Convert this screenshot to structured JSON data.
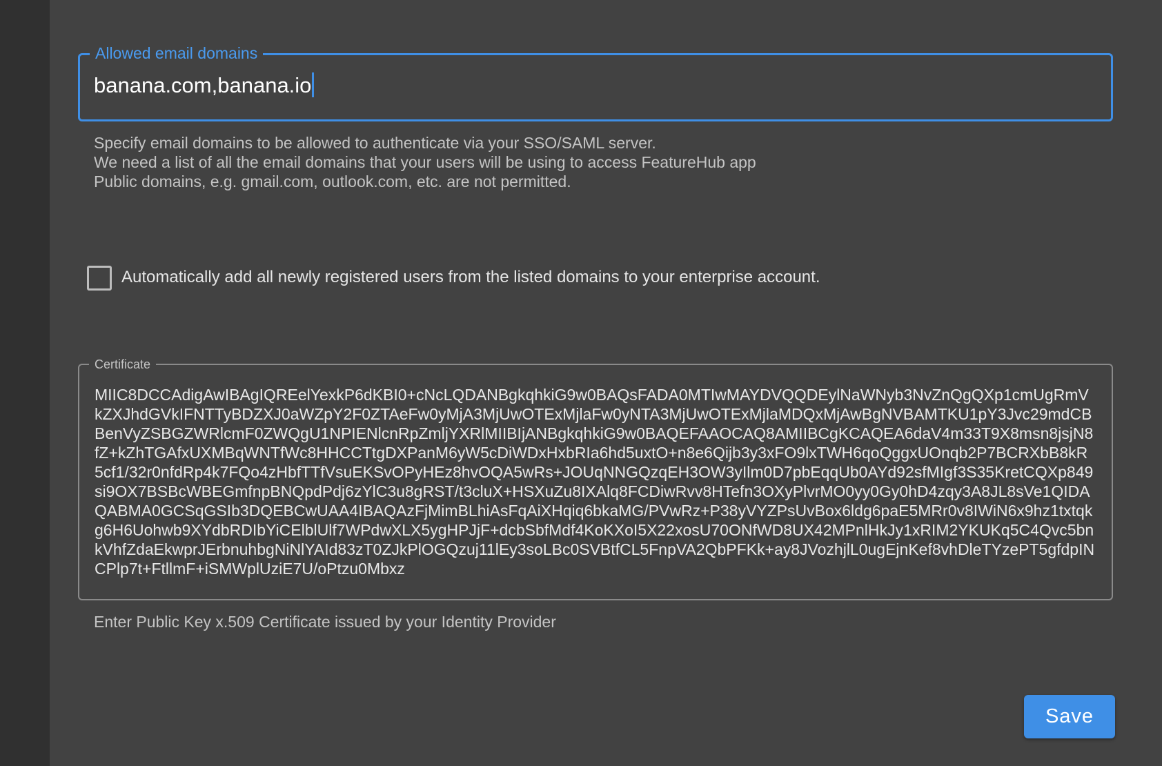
{
  "colors": {
    "accent": "#3f8fe6",
    "panel_background": "#424242",
    "rail_background": "#303030"
  },
  "email_domains": {
    "label": "Allowed email domains",
    "value": "banana.com,banana.io",
    "helper_lines": [
      "Specify email domains to be allowed to authenticate via your SSO/SAML server.",
      "We need a list of all the email domains that your users will be using to access FeatureHub app",
      "Public domains, e.g. gmail.com, outlook.com, etc. are not permitted."
    ]
  },
  "auto_add": {
    "checked": false,
    "label": "Automatically add all newly registered users from the listed domains to your enterprise account."
  },
  "certificate": {
    "label": "Certificate",
    "value": "MIIC8DCCAdigAwIBAgIQREelYexkP6dKBI0+cNcLQDANBgkqhkiG9w0BAQsFADA0MTIwMAYDVQQDEylNaWNyb3NvZnQgQXp1cmUgRmVkZXJhdGVkIFNTTyBDZXJ0aWZpY2F0ZTAeFw0yMjA3MjUwOTExMjlaFw0yNTA3MjUwOTExMjlaMDQxMjAwBgNVBAMTKU1pY3Jvc29mdCBBenVyZSBGZWRlcmF0ZWQgU1NPIENlcnRpZmljYXRlMIIBIjANBgkqhkiG9w0BAQEFAAOCAQ8AMIIBCgKCAQEA6daV4m33T9X8msn8jsjN8fZ+kZhTGAfxUXMBqWNTfWc8HHCCTtgDXPanM6yW5cDiWDxHxbRIa6hd5uxtO+n8e6Qijb3y3xFO9lxTWH6qoQggxUOnqb2P7BCRXbB8kR5cf1/32r0nfdRp4k7FQo4zHbfTTfVsuEKSvOPyHEz8hvOQA5wRs+JOUqNNGQzqEH3OW3yIlm0D7pbEqqUb0AYd92sfMIgf3S35KretCQXp849si9OX7BSBcWBEGmfnpBNQpdPdj6zYlC3u8gRST/t3cluX+HSXuZu8IXAlq8FCDiwRvv8HTefn3OXyPlvrMO0yy0Gy0hD4zqy3A8JL8sVe1QIDAQABMA0GCSqGSIb3DQEBCwUAA4IBAQAzFjMimBLhiAsFqAiXHqiq6bkaMG/PVwRz+P38yVYZPsUvBox6ldg6paE5MRr0v8IWiN6x9hz1txtqkg6H6Uohwb9XYdbRDIbYiCElblUlf7WPdwXLX5ygHPJjF+dcbSbfMdf4KoKXoI5X22xosU70ONfWD8UX42MPnlHkJy1xRIM2YKUKq5C4Qvc5bnkVhfZdaEkwprJErbnuhbgNiNlYAId83zT0ZJkPlOGQzuj11lEy3soLBc0SVBtfCL5FnpVA2QbPFKk+ay8JVozhjlL0ugEjnKef8vhDleTYzePT5gfdpINCPlp7t+FtllmF+iSMWplUziE7U/oPtzu0Mbxz",
    "helper": "Enter Public Key x.509 Certificate issued by your Identity Provider"
  },
  "actions": {
    "save_label": "Save"
  }
}
